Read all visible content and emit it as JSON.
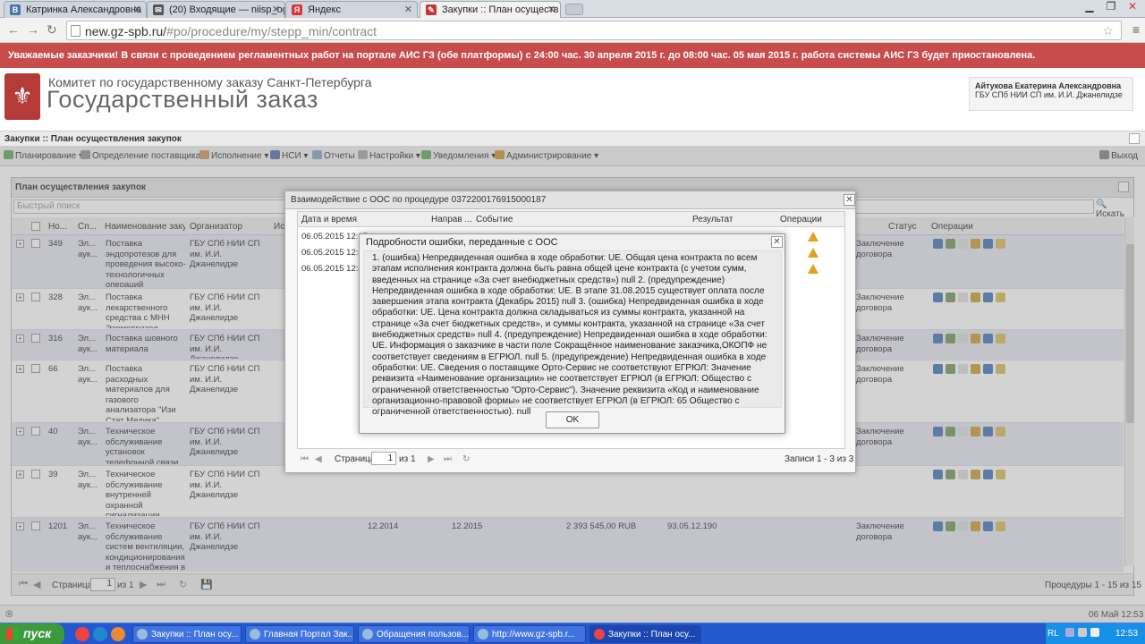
{
  "browser": {
    "tabs": [
      {
        "label": "Катринка Александровна",
        "icon_color": "#4a76a8",
        "icon": "vk-icon"
      },
      {
        "label": "(20) Входящие — niisp_ogz",
        "icon_color": "#444",
        "icon": "mail-icon"
      },
      {
        "label": "Яндекс",
        "icon_color": "#d33",
        "icon": "yandex-icon"
      },
      {
        "label": "Закупки :: План осуществ",
        "icon_color": "#c33",
        "icon": "page-icon"
      }
    ],
    "url_host": "new.gz-spb.ru/",
    "url_rest": "#po/procedure/my/stepp_min/contract"
  },
  "banner": "Уважаемые заказчики! В связи с проведением регламентных работ на портале АИС ГЗ (обе платформы) с 24:00 час. 30 апреля 2015 г. до 08:00 час. 05 мая 2015 г. работа системы АИС ГЗ будет приостановлена.",
  "header": {
    "line1": "Комитет по государственному заказу Санкт-Петербурга",
    "line2": "Государственный заказ",
    "user_name": "Айтукова Екатерина Александровна",
    "user_org": "ГБУ СПб НИИ СП им. И.И. Джанелидзе"
  },
  "breadcrumb": "Закупки :: План осуществления закупок",
  "menu": [
    "Планирование",
    "Определение поставщика",
    "Исполнение",
    "НСИ",
    "Отчеты",
    "Настройки",
    "Уведомления",
    "Администрирование"
  ],
  "logout": "Выход",
  "panel": {
    "title": "План осуществления закупок",
    "search_placeholder": "Быстрый поиск",
    "search_button": "Искать",
    "columns": [
      "Но...",
      "Сп...",
      "Наименование закуп...",
      "Организатор",
      "Исп",
      "Статус",
      "Операции"
    ],
    "rows": [
      {
        "no": "349",
        "sp": "Эл... аук...",
        "name": "Поставка эндопротезов для проведения высоко-технологичных операций",
        "org": "ГБУ СПб НИИ СП им. И.И. Джанелидзе",
        "status": "Заключение договора",
        "extra": [
          "",
          "",
          "",
          "",
          ""
        ]
      },
      {
        "no": "328",
        "sp": "Эл... аук...",
        "name": "Поставка лекарственного средства с МНН Эзомепразол",
        "org": "ГБУ СПб НИИ СП им. И.И. Джанелидзе",
        "status": "Заключение договора",
        "extra": [
          "",
          "",
          "",
          "",
          ""
        ]
      },
      {
        "no": "316",
        "sp": "Эл... аук...",
        "name": "Поставка шовного материала",
        "org": "ГБУ СПб НИИ СП им. И.И. Джанелидзе",
        "status": "Заключение договора",
        "extra": [
          "",
          "",
          "",
          "",
          ""
        ]
      },
      {
        "no": "66",
        "sp": "Эл... аук...",
        "name": "Поставка расходных материалов для газового анализатора \"Изи Стат Медика\"",
        "org": "ГБУ СПб НИИ СП им. И.И. Джанелидзе",
        "status": "Заключение договора",
        "extra": [
          "",
          "",
          "",
          "",
          ""
        ]
      },
      {
        "no": "40",
        "sp": "Эл... аук...",
        "name": "Техническое обслуживание установок телефонной связи",
        "org": "ГБУ СПб НИИ СП им. И.И. Джанелидзе",
        "status": "Заключение договора",
        "extra": [
          "",
          "",
          "",
          "",
          ""
        ]
      },
      {
        "no": "39",
        "sp": "Эл... аук...",
        "name": "Техническое обслуживание внутренней охранной сигнализации",
        "org": "ГБУ СПб НИИ СП им. И.И. Джанелидзе",
        "status": "",
        "extra": [
          "",
          "",
          "",
          "",
          ""
        ]
      },
      {
        "no": "1201",
        "sp": "Эл... аук...",
        "name": "Техническое обслуживание систем вентиляции, кондиционирования и теплоснабжения в ГБУ СПб СП",
        "org": "ГБУ СПб НИИ СП им. И.И. Джанелидзе",
        "status": "Заключение договора",
        "extra": [
          "12.2014",
          "12.2015",
          "2 393 545,00 RUB",
          "93.05.12.190",
          ""
        ]
      }
    ],
    "pager": {
      "page_label": "Страница",
      "page": "1",
      "of": "из 1",
      "summary": "Процедуры 1 - 15 из 15"
    }
  },
  "dialog_interaction": {
    "title": "Взаимодействие с ООС по процедуре 0372200176915000187",
    "columns": [
      "Дата и время",
      "Направ ...",
      "Событие",
      "Результат",
      "Операции"
    ],
    "rows": [
      "06.05.2015 12:17:...",
      "06.05.2015 12:39:...",
      "06.05.2015 12:46:..."
    ],
    "page_label": "Страница",
    "page": "1",
    "of": "из 1",
    "summary": "Записи 1 - 3 из 3"
  },
  "dialog_error": {
    "title": "Подробности ошибки, переданные с ООС",
    "text": "1. (ошибка) Непредвиденная ошибка в ходе обработки: UE. Общая цена контракта по всем этапам исполнения контракта должна быть равна общей цене контракта (с учетом сумм, введенных на странице «За счет внебюджетных средств») null 2. (предупреждение) Непредвиденная ошибка в ходе обработки: UE. В этапе 31.08.2015 существует оплата после завершения этапа контракта (Декабрь 2015) null 3. (ошибка) Непредвиденная ошибка в ходе обработки: UE. Цена контракта должна складываться из суммы контракта, указанной на странице «За счет бюджетных средств», и суммы контракта, указанной на странице «За счет внебюджетных средств» null 4. (предупреждение) Непредвиденная ошибка в ходе обработки: UE. Информация о заказчике в части поле Сокращённое наименование заказчика,ОКОПФ не соответствует сведениям в ЕГРЮЛ. null 5. (предупреждение) Непредвиденная ошибка в ходе обработки: UE. Сведения о поставщике Орто-Сервис не соответствуют ЕГРЮЛ: Значение реквизита «Наименование организации» не соответствует ЕГРЮЛ (в ЕГРЮЛ: Общество с ограниченной ответственностью \"Орто-Сервис\"). Значение реквизита «Код и наименование организационно-правовой формы» не соответствует ЕГРЮЛ (в ЕГРЮЛ: 65 Общество с ограниченной ответственностью). null",
    "ok": "OK"
  },
  "statusbar": {
    "datetime": "06 Май 12:53"
  },
  "taskbar": {
    "start": "пуск",
    "tasks": [
      "Закупки :: План осу...",
      "Главная Портал Зак...",
      "Обращения пользов...",
      "http://www.gz-spb.r...",
      "Закупки :: План осу..."
    ],
    "lang": "RL",
    "clock": "12:53"
  }
}
